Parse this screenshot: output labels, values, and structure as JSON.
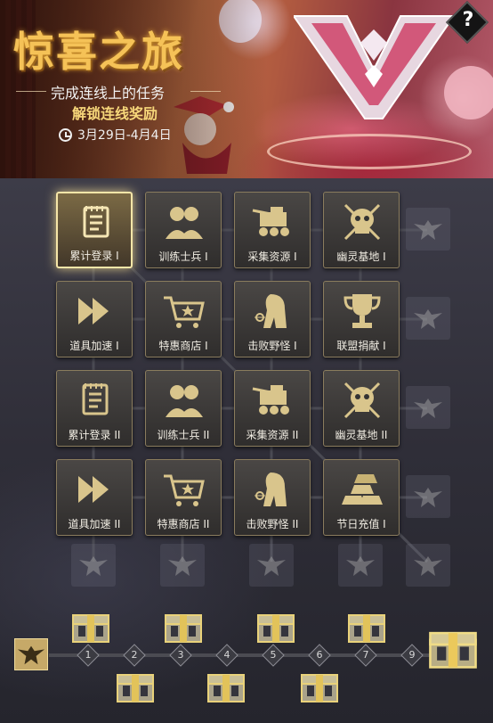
{
  "banner": {
    "title": "惊喜之旅",
    "subtitle_line1": "完成连线上的任务",
    "subtitle_line2": "解锁连线奖励",
    "date_range": "3月29日-4月4日",
    "help_label": "?"
  },
  "tasks": [
    {
      "label": "累计登录 I",
      "icon": "notepad-icon",
      "active": true
    },
    {
      "label": "训练士兵 I",
      "icon": "soldiers-icon"
    },
    {
      "label": "采集资源 I",
      "icon": "harvester-icon"
    },
    {
      "label": "幽灵基地 I",
      "icon": "skull-icon"
    },
    {
      "label": "道具加速 I",
      "icon": "fast-forward-icon"
    },
    {
      "label": "特惠商店 I",
      "icon": "shopping-cart-icon"
    },
    {
      "label": "击败野怪 I",
      "icon": "monster-icon"
    },
    {
      "label": "联盟捐献 I",
      "icon": "trophy-icon"
    },
    {
      "label": "累计登录 II",
      "icon": "notepad-icon"
    },
    {
      "label": "训练士兵 II",
      "icon": "soldiers-icon"
    },
    {
      "label": "采集资源 II",
      "icon": "harvester-icon"
    },
    {
      "label": "幽灵基地 II",
      "icon": "skull-icon"
    },
    {
      "label": "道具加速 II",
      "icon": "fast-forward-icon"
    },
    {
      "label": "特惠商店 II",
      "icon": "shopping-cart-icon"
    },
    {
      "label": "击败野怪 II",
      "icon": "monster-icon"
    },
    {
      "label": "节日充值 I",
      "icon": "gold-bars-icon"
    }
  ],
  "track": {
    "nodes": [
      "1",
      "2",
      "3",
      "4",
      "5",
      "6",
      "7",
      "9"
    ]
  },
  "colors": {
    "accent_gold": "#f5c257",
    "tile_border": "#8a7c5d",
    "active_border": "#f6e6a8"
  }
}
